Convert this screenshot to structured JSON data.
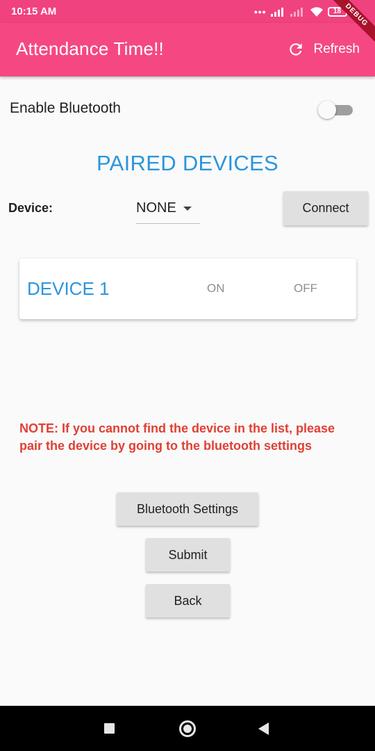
{
  "status_bar": {
    "time": "10:15 AM",
    "signal_dots": "•••",
    "battery": "18"
  },
  "app_bar": {
    "title": "Attendance Time!!",
    "refresh_label": "Refresh",
    "debug_banner": "DEBUG"
  },
  "bluetooth": {
    "enable_label": "Enable Bluetooth",
    "enabled": false
  },
  "paired_devices": {
    "heading": "PAIRED DEVICES",
    "device_label": "Device:",
    "selected_device": "NONE",
    "connect_label": "Connect"
  },
  "device_card": {
    "name": "DEVICE 1",
    "on_label": "ON",
    "off_label": "OFF"
  },
  "note": "NOTE: If you cannot find the device in the list, please pair the device by going to the bluetooth settings",
  "actions": {
    "bluetooth_settings": "Bluetooth Settings",
    "submit": "Submit",
    "back": "Back"
  },
  "colors": {
    "app_bar": "#f54883",
    "accent_blue": "#2b95de",
    "note_red": "#e04035",
    "button_grey": "#e0e0e0"
  }
}
